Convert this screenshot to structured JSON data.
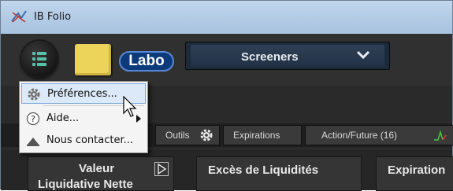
{
  "window": {
    "title": "IB Folio"
  },
  "toolbar": {
    "labo_label": "Labo",
    "screeners_label": "Screeners"
  },
  "popup_menu": {
    "items": [
      {
        "label": "Préférences...",
        "icon": "gear-icon"
      },
      {
        "label": "Aide...",
        "icon": "help-icon"
      },
      {
        "label": "Nous contacter...",
        "icon": "contact-icon"
      }
    ]
  },
  "tabs": [
    {
      "label": "Outils"
    },
    {
      "label": "Expirations"
    },
    {
      "label": "Action/Future (16)"
    }
  ],
  "columns": [
    {
      "line1": "Valeur",
      "line2": "Liquidative Nette"
    },
    {
      "label": "Excès de Liquidités"
    },
    {
      "label": "Expiration"
    }
  ],
  "colors": {
    "titlebar": "#b3cbe5",
    "background": "#2a2a2a",
    "labo_button": "#0d3a7b",
    "note_yellow": "#ecd35a",
    "menu_highlight": "#dbe9f8"
  }
}
